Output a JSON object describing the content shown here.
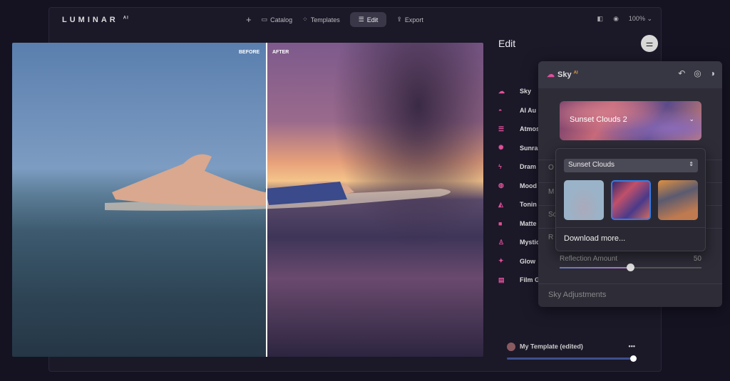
{
  "app": {
    "logo": "LUMINAR",
    "logo_sup": "AI"
  },
  "nav": {
    "add": "+",
    "catalog": "Catalog",
    "templates": "Templates",
    "edit": "Edit",
    "export": "Export",
    "zoom": "100%"
  },
  "photo": {
    "before": "BEFORE",
    "after": "AFTER"
  },
  "edit": {
    "title": "Edit"
  },
  "tools": [
    {
      "label": "Sky",
      "icon": "cloud-icon"
    },
    {
      "label": "AI Au",
      "icon": "cloud-half-icon"
    },
    {
      "label": "Atmos",
      "icon": "lines-icon"
    },
    {
      "label": "Sunra",
      "icon": "sun-icon"
    },
    {
      "label": "Dram",
      "icon": "bolt-icon"
    },
    {
      "label": "Mood",
      "icon": "mood-icon"
    },
    {
      "label": "Tonin",
      "icon": "bucket-icon"
    },
    {
      "label": "Matte",
      "icon": "square-icon"
    },
    {
      "label": "Mystic",
      "icon": "person-icon"
    },
    {
      "label": "Glow",
      "icon": "sparkle-icon"
    },
    {
      "label": "Film G",
      "icon": "film-icon"
    }
  ],
  "template": {
    "name": "My Template (edited)",
    "more": "•••",
    "amount": 100
  },
  "panel": {
    "title": "Sky",
    "title_sup": "AI",
    "selected_sky": "Sunset Clouds 2",
    "hidden_rows": [
      "O",
      "M",
      "Sc",
      "R"
    ],
    "reflection_label": "Reflection Amount",
    "reflection_value": "50",
    "sky_adjustments": "Sky Adjustments"
  },
  "dropdown": {
    "category": "Sunset Clouds",
    "download": "Download more...",
    "selected_index": 1
  },
  "colors": {
    "accent": "#e0509a",
    "selection": "#3a7ae0"
  }
}
